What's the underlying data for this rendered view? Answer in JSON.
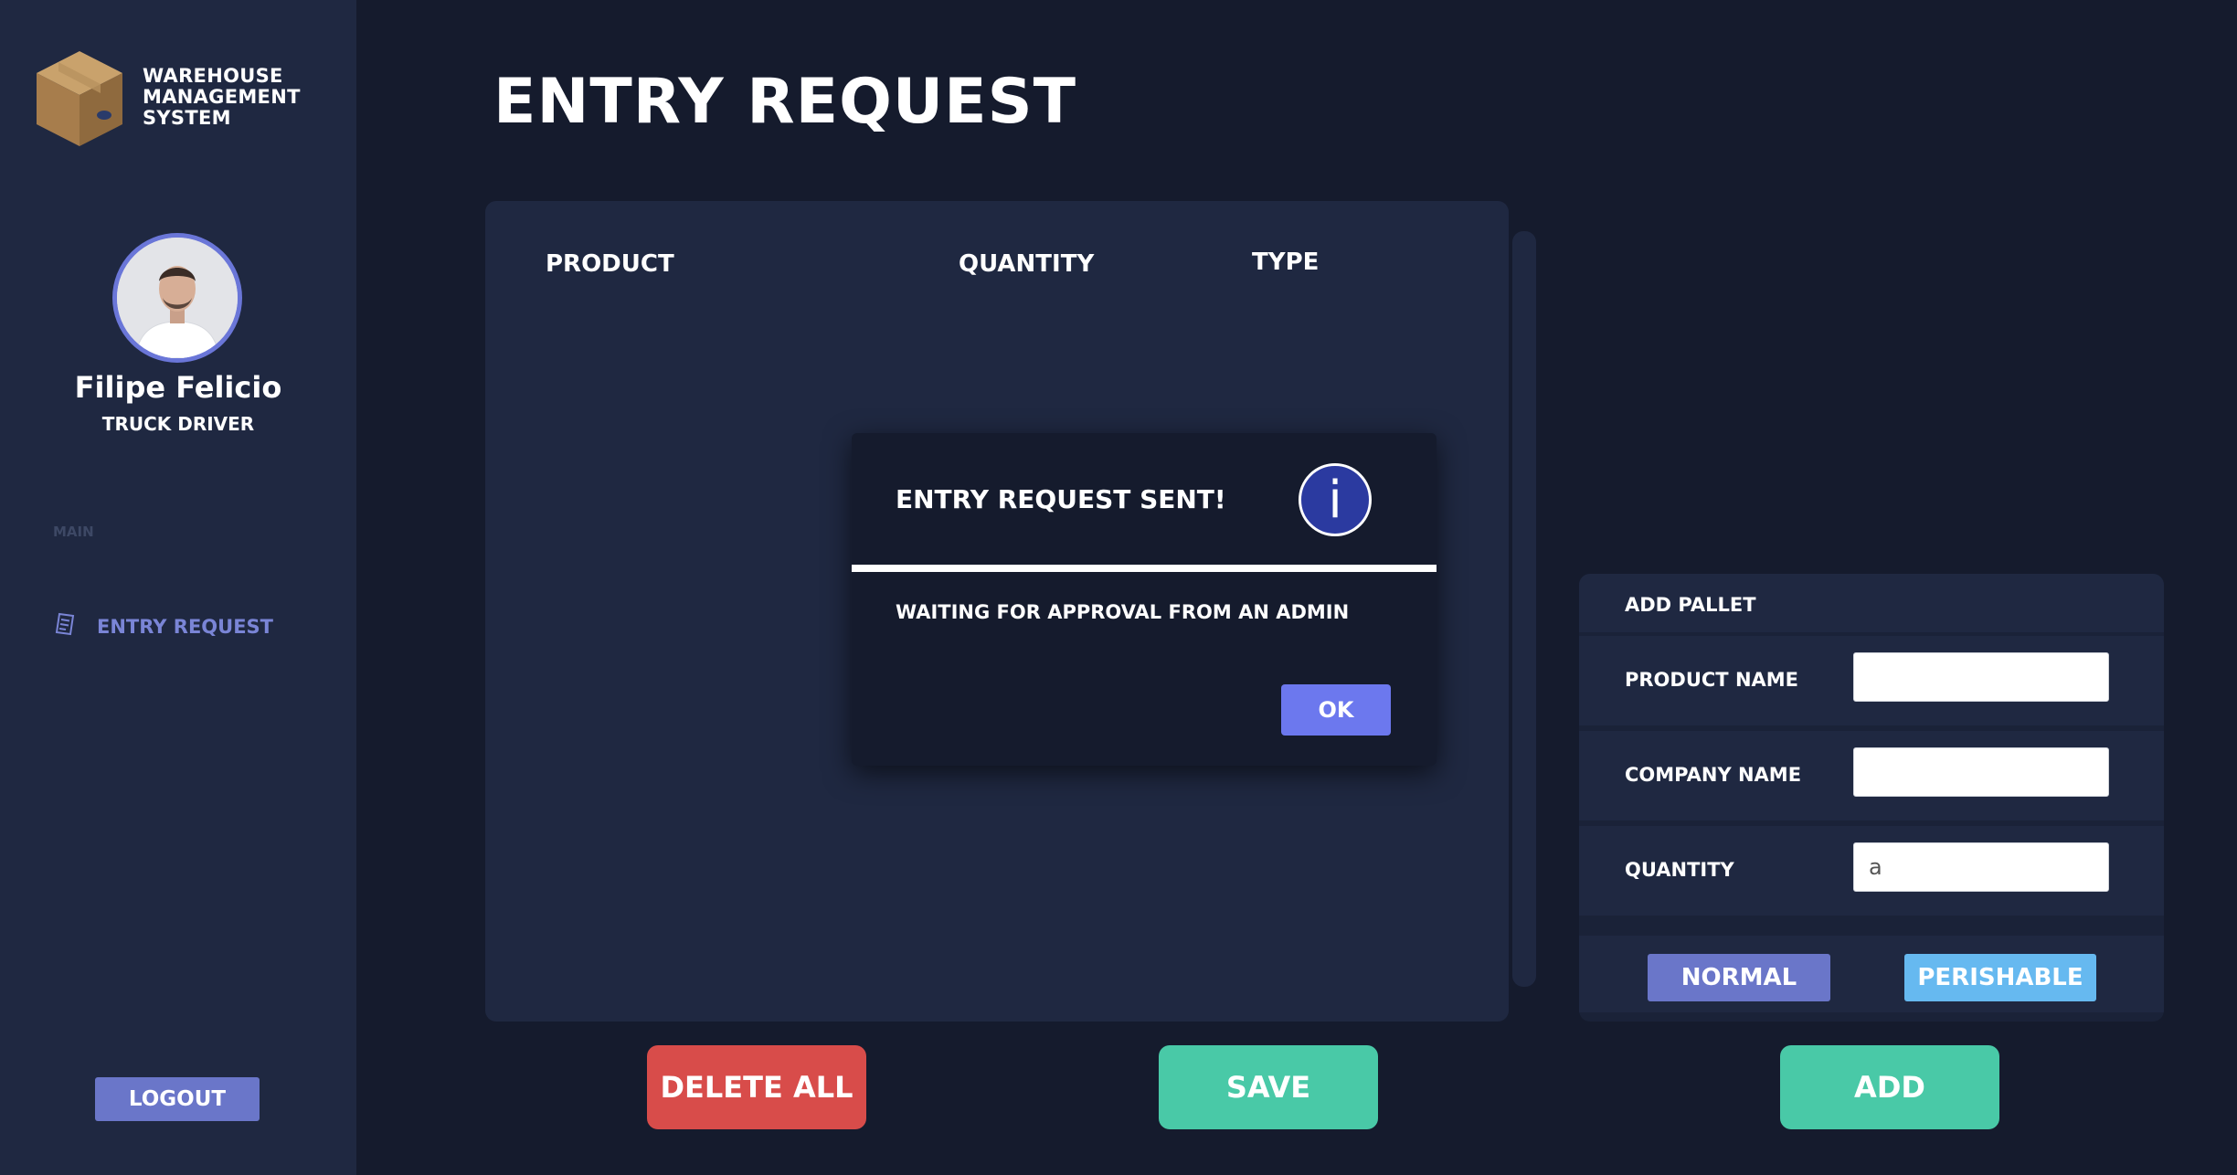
{
  "sidebar": {
    "app_title_lines": [
      "WAREHOUSE",
      "MANAGEMENT",
      "SYSTEM"
    ],
    "user": {
      "name": "Filipe Felicio",
      "role": "TRUCK DRIVER"
    },
    "section_label": "MAIN",
    "nav_items": [
      {
        "label": "ENTRY REQUEST",
        "icon": "document-list-icon"
      }
    ],
    "logout_label": "LOGOUT"
  },
  "main": {
    "title": "ENTRY REQUEST",
    "table": {
      "columns": [
        "PRODUCT",
        "QUANTITY",
        "TYPE"
      ],
      "rows": []
    },
    "buttons": {
      "delete_all": "DELETE ALL",
      "save": "SAVE"
    }
  },
  "modal": {
    "title": "ENTRY REQUEST SENT!",
    "icon": "info-icon",
    "icon_glyph": "i",
    "message": "WAITING FOR APPROVAL FROM AN ADMIN",
    "ok_label": "OK"
  },
  "pallet": {
    "header": "ADD PALLET",
    "fields": [
      {
        "label": "PRODUCT NAME",
        "value": ""
      },
      {
        "label": "COMPANY NAME",
        "value": ""
      },
      {
        "label": "QUANTITY",
        "value": "a"
      }
    ],
    "type_buttons": {
      "normal": "NORMAL",
      "perishable": "PERISHABLE"
    },
    "add_label": "ADD"
  },
  "colors": {
    "background": "#151b2d",
    "panel": "#1f2841",
    "accent": "#6a76c9",
    "danger": "#d84c4a",
    "success": "#49c9a7",
    "info": "#66b9f0"
  }
}
